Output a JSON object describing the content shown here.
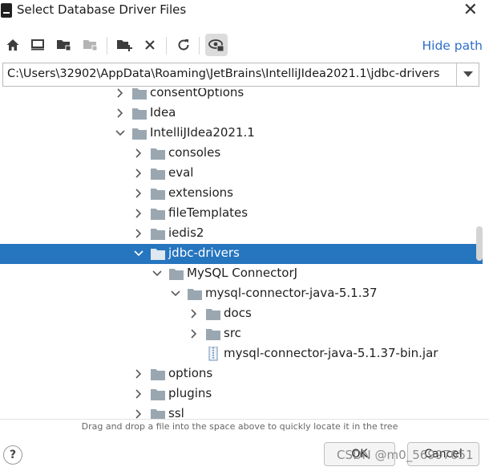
{
  "window": {
    "title": "Select Database Driver Files",
    "close_icon": "close-icon"
  },
  "toolbar": {
    "buttons": [
      {
        "name": "home-icon"
      },
      {
        "name": "desktop-icon"
      },
      {
        "name": "project-folder-icon"
      },
      {
        "name": "module-folder-icon"
      },
      {
        "name": "new-folder-icon"
      },
      {
        "name": "delete-icon"
      },
      {
        "name": "refresh-icon"
      },
      {
        "name": "show-hidden-icon"
      }
    ],
    "hide_path_label": "Hide path"
  },
  "path": {
    "value": "C:\\Users\\32902\\AppData\\Roaming\\JetBrains\\IntelliJIdea2021.1\\jdbc-drivers"
  },
  "tree": {
    "rows": [
      {
        "label": "consentOptions",
        "depth": 0,
        "expanded": false,
        "icon": "folder-icon",
        "selected": false
      },
      {
        "label": "Idea",
        "depth": 0,
        "expanded": false,
        "icon": "folder-icon",
        "selected": false
      },
      {
        "label": "IntelliJIdea2021.1",
        "depth": 0,
        "expanded": true,
        "icon": "folder-icon",
        "selected": false
      },
      {
        "label": "consoles",
        "depth": 1,
        "expanded": false,
        "icon": "folder-icon",
        "selected": false
      },
      {
        "label": "eval",
        "depth": 1,
        "expanded": false,
        "icon": "folder-icon",
        "selected": false
      },
      {
        "label": "extensions",
        "depth": 1,
        "expanded": false,
        "icon": "folder-icon",
        "selected": false
      },
      {
        "label": "fileTemplates",
        "depth": 1,
        "expanded": false,
        "icon": "folder-icon",
        "selected": false
      },
      {
        "label": "iedis2",
        "depth": 1,
        "expanded": false,
        "icon": "folder-icon",
        "selected": false
      },
      {
        "label": "jdbc-drivers",
        "depth": 1,
        "expanded": true,
        "icon": "folder-icon",
        "selected": true
      },
      {
        "label": "MySQL ConnectorJ",
        "depth": 2,
        "expanded": true,
        "icon": "folder-icon",
        "selected": false
      },
      {
        "label": "mysql-connector-java-5.1.37",
        "depth": 3,
        "expanded": true,
        "icon": "folder-icon",
        "selected": false
      },
      {
        "label": "docs",
        "depth": 4,
        "expanded": false,
        "icon": "folder-icon",
        "selected": false
      },
      {
        "label": "src",
        "depth": 4,
        "expanded": false,
        "icon": "folder-icon",
        "selected": false
      },
      {
        "label": "mysql-connector-java-5.1.37-bin.jar",
        "depth": 4,
        "expanded": null,
        "icon": "jar-file-icon",
        "selected": false
      },
      {
        "label": "options",
        "depth": 1,
        "expanded": false,
        "icon": "folder-icon",
        "selected": false
      },
      {
        "label": "plugins",
        "depth": 1,
        "expanded": false,
        "icon": "folder-icon",
        "selected": false
      },
      {
        "label": "ssl",
        "depth": 1,
        "expanded": false,
        "icon": "folder-icon",
        "selected": false
      }
    ]
  },
  "hint": "Drag and drop a file into the space above to quickly locate it in the tree",
  "footer": {
    "help_label": "?",
    "ok_label": "OK",
    "cancel_label": "Cancel",
    "watermark": "CSDN @m0_56997651"
  },
  "colors": {
    "selection": "#2675bf",
    "link": "#2f6fca",
    "folder": "#9aa7b0"
  }
}
